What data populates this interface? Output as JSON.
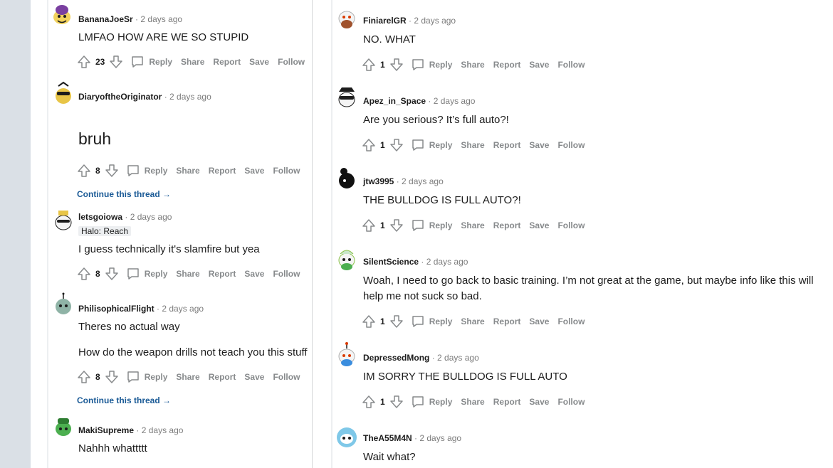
{
  "actions": {
    "reply": "Reply",
    "share": "Share",
    "report": "Report",
    "save": "Save",
    "follow": "Follow"
  },
  "continue_label": "Continue this thread →",
  "left_comments": [
    {
      "author": "BananaJoeSr",
      "time": "2 days ago",
      "body": "LMFAO HOW ARE WE SO STUPID",
      "score": "23"
    },
    {
      "author": "DiaryoftheOriginator",
      "time": "2 days ago",
      "body": "bruh",
      "score": "8"
    },
    {
      "author": "letsgoiowa",
      "time": "2 days ago",
      "flair": "Halo: Reach",
      "body": "I guess technically it's slamfire but yea",
      "score": "8"
    },
    {
      "author": "PhilisophicalFlight",
      "time": "2 days ago",
      "body": "Theres no actual way",
      "body2": "How do the weapon drills not teach you this stuff",
      "score": "8"
    },
    {
      "author": "MakiSupreme",
      "time": "2 days ago",
      "body": "Nahhh whattttt"
    }
  ],
  "right_comments": [
    {
      "author": "FiniarelGR",
      "time": "2 days ago",
      "body": "NO. WHAT",
      "score": "1"
    },
    {
      "author": "Apez_in_Space",
      "time": "2 days ago",
      "body": "Are you serious? It’s full auto?!",
      "score": "1"
    },
    {
      "author": "jtw3995",
      "time": "2 days ago",
      "body": "THE BULLDOG IS FULL AUTO?!",
      "score": "1"
    },
    {
      "author": "SilentScience",
      "time": "2 days ago",
      "body": "Woah, I need to go back to basic training. I’m not great at the game, but maybe info like this will",
      "body2": "help me not suck so bad.",
      "score": "1"
    },
    {
      "author": "DepressedMong",
      "time": "2 days ago",
      "body": "IM SORRY THE BULLDOG IS FULL AUTO",
      "score": "1"
    },
    {
      "author": "TheA55M4N",
      "time": "2 days ago",
      "body": "Wait what?"
    }
  ],
  "colors": {
    "gutter": "#dae0e6",
    "muted": "#878a8c",
    "link": "#1a5a96",
    "text": "#1c1c1c"
  },
  "icons": [
    "upvote-icon",
    "downvote-icon",
    "comment-bubble-icon",
    "snoo-avatar-icon",
    "arrow-right-icon"
  ]
}
